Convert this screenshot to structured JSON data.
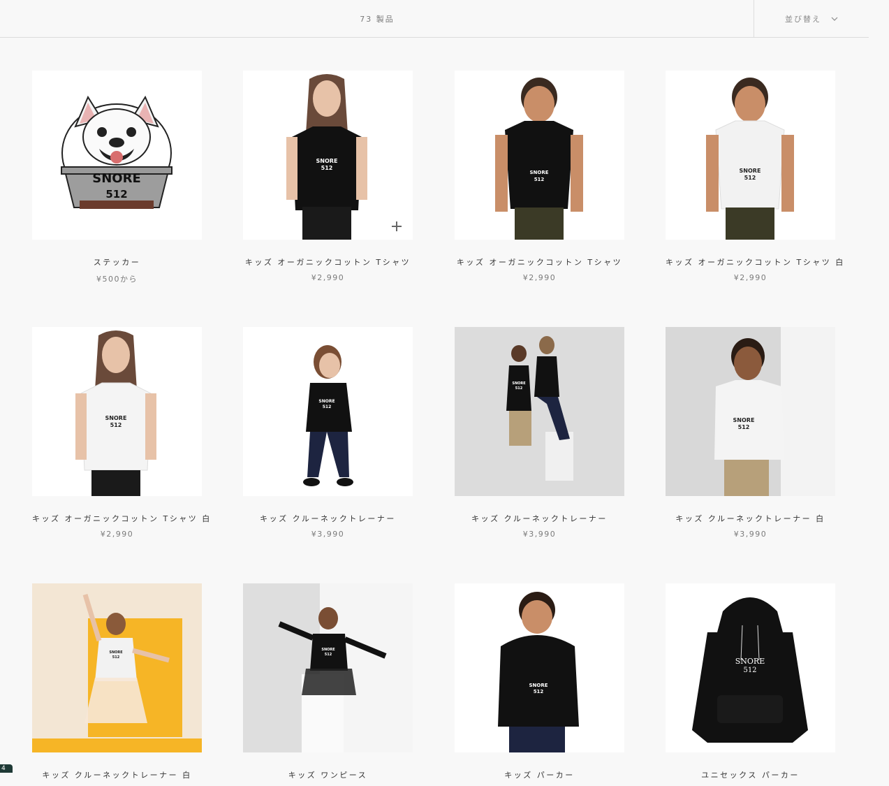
{
  "toolbar": {
    "count": "73 製品",
    "sort_label": "並び替え"
  },
  "products": [
    {
      "title": "ステッカー",
      "price": "¥500から",
      "image": "sticker"
    },
    {
      "title": "キッズ オーガニックコットン Tシャツ",
      "price": "¥2,990",
      "image": "girl-black-tee"
    },
    {
      "title": "キッズ オーガニックコットン Tシャツ",
      "price": "¥2,990",
      "image": "boy-black-tee"
    },
    {
      "title": "キッズ オーガニックコットン Tシャツ 白",
      "price": "¥2,990",
      "image": "boy-white-tee"
    },
    {
      "title": "キッズ オーガニックコットン Tシャツ 白",
      "price": "¥2,990",
      "image": "girl-white-tee"
    },
    {
      "title": "キッズ クルーネックトレーナー",
      "price": "¥3,990",
      "image": "girl-black-sweat"
    },
    {
      "title": "キッズ クルーネックトレーナー",
      "price": "¥3,990",
      "image": "two-kids-black-sweat"
    },
    {
      "title": "キッズ クルーネックトレーナー 白",
      "price": "¥3,990",
      "image": "boy-white-sweat"
    },
    {
      "title": "キッズ クルーネックトレーナー 白",
      "price": "",
      "image": "girl-jumping-white-sweat"
    },
    {
      "title": "キッズ ワンピース",
      "price": "",
      "image": "girl-black-dress"
    },
    {
      "title": "キッズ パーカー",
      "price": "",
      "image": "boy-black-hoodie"
    },
    {
      "title": "ユニセックス パーカー",
      "price": "",
      "image": "black-hoodie"
    }
  ],
  "print": {
    "brand": "SNORE",
    "number": "512"
  },
  "badge": "4",
  "colors": {
    "background": "#f8f8f8",
    "text": "#333333",
    "muted": "#7a7a7a"
  }
}
